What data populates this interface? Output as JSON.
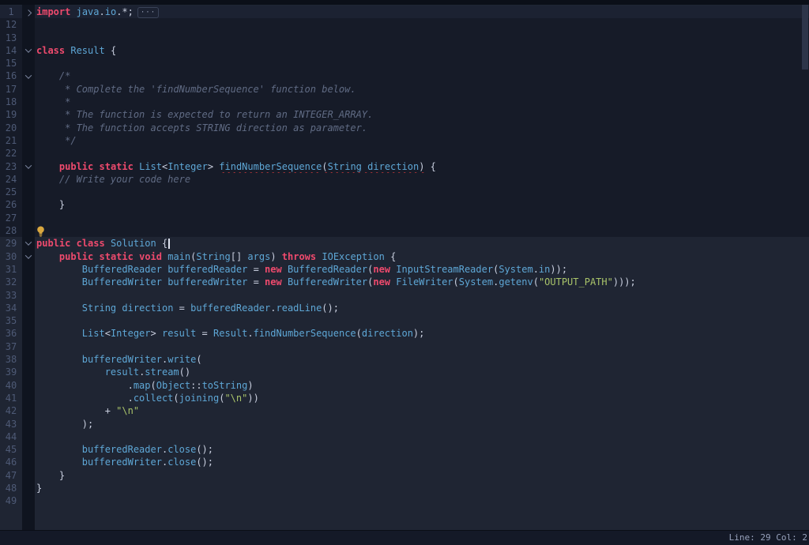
{
  "editor": {
    "language": "java",
    "fold_ellipsis": "···",
    "status_bar": {
      "text": "Line: 29 Col: 2"
    },
    "shade": {
      "dark_through": 28,
      "highlight_line": 1
    },
    "colors": {
      "keyword": "#ee4a6d",
      "identifier": "#5ea7d6",
      "punctuation": "#c9cfdf",
      "comment": "#606b84",
      "string": "#a9c46a",
      "line_number": "#4e5a76",
      "error_underline": "#e23c3c",
      "bg_dark_region": "#161b28",
      "bg_light_region": "#1f2533",
      "bg_highlight_line": "#1c2232",
      "gutter_strip": "#0f141f",
      "top_strip": "#0b0f18",
      "status_bar_bg": "#141927",
      "status_text": "#97a1bb",
      "cursor": "#dde2ee",
      "lightbulb": "#d9a73f",
      "chevron": "#79839c",
      "scroll_thumb": "#2d3549",
      "badge_border": "#3a4358"
    },
    "lines": [
      {
        "num": 1,
        "fold": "closed",
        "badge": true,
        "tokens": [
          {
            "s": "import",
            "c": "kw"
          },
          {
            "s": " ",
            "c": "pl"
          },
          {
            "s": "java",
            "c": "id"
          },
          {
            "s": ".",
            "c": "pu"
          },
          {
            "s": "io",
            "c": "id"
          },
          {
            "s": ".*;",
            "c": "pu"
          }
        ]
      },
      {
        "num": 12,
        "tokens": []
      },
      {
        "num": 13,
        "tokens": []
      },
      {
        "num": 14,
        "fold": "open",
        "tokens": [
          {
            "s": "class",
            "c": "kw"
          },
          {
            "s": " ",
            "c": "pl"
          },
          {
            "s": "Result",
            "c": "id"
          },
          {
            "s": " {",
            "c": "pu"
          }
        ]
      },
      {
        "num": 15,
        "tokens": []
      },
      {
        "num": 16,
        "fold": "open",
        "tokens": [
          {
            "s": "    ",
            "c": "pl"
          },
          {
            "s": "/*",
            "c": "co"
          }
        ]
      },
      {
        "num": 17,
        "tokens": [
          {
            "s": "     * Complete the 'findNumberSequence' function below.",
            "c": "co"
          }
        ]
      },
      {
        "num": 18,
        "tokens": [
          {
            "s": "     *",
            "c": "co"
          }
        ]
      },
      {
        "num": 19,
        "tokens": [
          {
            "s": "     * The function is expected to return an INTEGER_ARRAY.",
            "c": "co"
          }
        ]
      },
      {
        "num": 20,
        "tokens": [
          {
            "s": "     * The function accepts STRING direction as parameter.",
            "c": "co"
          }
        ]
      },
      {
        "num": 21,
        "tokens": [
          {
            "s": "     */",
            "c": "co"
          }
        ]
      },
      {
        "num": 22,
        "tokens": []
      },
      {
        "num": 23,
        "fold": "open",
        "tokens": [
          {
            "s": "    ",
            "c": "pl"
          },
          {
            "s": "public",
            "c": "kw"
          },
          {
            "s": " ",
            "c": "pl"
          },
          {
            "s": "static",
            "c": "kw"
          },
          {
            "s": " ",
            "c": "pl"
          },
          {
            "s": "List",
            "c": "id"
          },
          {
            "s": "<",
            "c": "pu"
          },
          {
            "s": "Integer",
            "c": "id"
          },
          {
            "s": ">",
            "c": "pu"
          },
          {
            "s": " ",
            "c": "pl"
          },
          {
            "s": "findNumberSequence",
            "c": "id sq"
          },
          {
            "s": "(",
            "c": "pu sq"
          },
          {
            "s": "String",
            "c": "id sq"
          },
          {
            "s": " ",
            "c": "pl sq"
          },
          {
            "s": "direction",
            "c": "id sq"
          },
          {
            "s": ")",
            "c": "pu sq"
          },
          {
            "s": " {",
            "c": "pu"
          }
        ]
      },
      {
        "num": 24,
        "tokens": [
          {
            "s": "    ",
            "c": "pl"
          },
          {
            "s": "// Write your code here",
            "c": "co"
          }
        ]
      },
      {
        "num": 25,
        "tokens": []
      },
      {
        "num": 26,
        "tokens": [
          {
            "s": "    }",
            "c": "pu"
          }
        ]
      },
      {
        "num": 27,
        "tokens": []
      },
      {
        "num": 28,
        "bulb": true,
        "tokens": []
      },
      {
        "num": 29,
        "fold": "open",
        "cursor": true,
        "tokens": [
          {
            "s": "public",
            "c": "kw"
          },
          {
            "s": " ",
            "c": "pl"
          },
          {
            "s": "class",
            "c": "kw"
          },
          {
            "s": " ",
            "c": "pl"
          },
          {
            "s": "Solution",
            "c": "id"
          },
          {
            "s": " ",
            "c": "pl"
          },
          {
            "s": "{",
            "c": "pu"
          }
        ]
      },
      {
        "num": 30,
        "fold": "open",
        "tokens": [
          {
            "s": "    ",
            "c": "pl"
          },
          {
            "s": "public",
            "c": "kw"
          },
          {
            "s": " ",
            "c": "pl"
          },
          {
            "s": "static",
            "c": "kw"
          },
          {
            "s": " ",
            "c": "pl"
          },
          {
            "s": "void",
            "c": "kw"
          },
          {
            "s": " ",
            "c": "pl"
          },
          {
            "s": "main",
            "c": "id"
          },
          {
            "s": "(",
            "c": "pu"
          },
          {
            "s": "String",
            "c": "id"
          },
          {
            "s": "[] ",
            "c": "pu"
          },
          {
            "s": "args",
            "c": "id"
          },
          {
            "s": ") ",
            "c": "pu"
          },
          {
            "s": "throws",
            "c": "kw"
          },
          {
            "s": " ",
            "c": "pl"
          },
          {
            "s": "IOException",
            "c": "id"
          },
          {
            "s": " {",
            "c": "pu"
          }
        ]
      },
      {
        "num": 31,
        "tokens": [
          {
            "s": "        ",
            "c": "pl"
          },
          {
            "s": "BufferedReader",
            "c": "id"
          },
          {
            "s": " ",
            "c": "pl"
          },
          {
            "s": "bufferedReader",
            "c": "id"
          },
          {
            "s": " = ",
            "c": "pu"
          },
          {
            "s": "new",
            "c": "kw"
          },
          {
            "s": " ",
            "c": "pl"
          },
          {
            "s": "BufferedReader",
            "c": "id"
          },
          {
            "s": "(",
            "c": "pu"
          },
          {
            "s": "new",
            "c": "kw"
          },
          {
            "s": " ",
            "c": "pl"
          },
          {
            "s": "InputStreamReader",
            "c": "id"
          },
          {
            "s": "(",
            "c": "pu"
          },
          {
            "s": "System",
            "c": "id"
          },
          {
            "s": ".",
            "c": "pu"
          },
          {
            "s": "in",
            "c": "id"
          },
          {
            "s": "));",
            "c": "pu"
          }
        ]
      },
      {
        "num": 32,
        "tokens": [
          {
            "s": "        ",
            "c": "pl"
          },
          {
            "s": "BufferedWriter",
            "c": "id"
          },
          {
            "s": " ",
            "c": "pl"
          },
          {
            "s": "bufferedWriter",
            "c": "id"
          },
          {
            "s": " = ",
            "c": "pu"
          },
          {
            "s": "new",
            "c": "kw"
          },
          {
            "s": " ",
            "c": "pl"
          },
          {
            "s": "BufferedWriter",
            "c": "id"
          },
          {
            "s": "(",
            "c": "pu"
          },
          {
            "s": "new",
            "c": "kw"
          },
          {
            "s": " ",
            "c": "pl"
          },
          {
            "s": "FileWriter",
            "c": "id"
          },
          {
            "s": "(",
            "c": "pu"
          },
          {
            "s": "System",
            "c": "id"
          },
          {
            "s": ".",
            "c": "pu"
          },
          {
            "s": "getenv",
            "c": "id"
          },
          {
            "s": "(",
            "c": "pu"
          },
          {
            "s": "\"OUTPUT_PATH\"",
            "c": "st"
          },
          {
            "s": ")));",
            "c": "pu"
          }
        ]
      },
      {
        "num": 33,
        "tokens": []
      },
      {
        "num": 34,
        "tokens": [
          {
            "s": "        ",
            "c": "pl"
          },
          {
            "s": "String",
            "c": "id"
          },
          {
            "s": " ",
            "c": "pl"
          },
          {
            "s": "direction",
            "c": "id"
          },
          {
            "s": " = ",
            "c": "pu"
          },
          {
            "s": "bufferedReader",
            "c": "id"
          },
          {
            "s": ".",
            "c": "pu"
          },
          {
            "s": "readLine",
            "c": "id"
          },
          {
            "s": "();",
            "c": "pu"
          }
        ]
      },
      {
        "num": 35,
        "tokens": []
      },
      {
        "num": 36,
        "tokens": [
          {
            "s": "        ",
            "c": "pl"
          },
          {
            "s": "List",
            "c": "id"
          },
          {
            "s": "<",
            "c": "pu"
          },
          {
            "s": "Integer",
            "c": "id"
          },
          {
            "s": "> ",
            "c": "pu"
          },
          {
            "s": "result",
            "c": "id"
          },
          {
            "s": " = ",
            "c": "pu"
          },
          {
            "s": "Result",
            "c": "id"
          },
          {
            "s": ".",
            "c": "pu"
          },
          {
            "s": "findNumberSequence",
            "c": "id"
          },
          {
            "s": "(",
            "c": "pu"
          },
          {
            "s": "direction",
            "c": "id"
          },
          {
            "s": ");",
            "c": "pu"
          }
        ]
      },
      {
        "num": 37,
        "tokens": []
      },
      {
        "num": 38,
        "tokens": [
          {
            "s": "        ",
            "c": "pl"
          },
          {
            "s": "bufferedWriter",
            "c": "id"
          },
          {
            "s": ".",
            "c": "pu"
          },
          {
            "s": "write",
            "c": "id"
          },
          {
            "s": "(",
            "c": "pu"
          }
        ]
      },
      {
        "num": 39,
        "tokens": [
          {
            "s": "            ",
            "c": "pl"
          },
          {
            "s": "result",
            "c": "id"
          },
          {
            "s": ".",
            "c": "pu"
          },
          {
            "s": "stream",
            "c": "id"
          },
          {
            "s": "()",
            "c": "pu"
          }
        ]
      },
      {
        "num": 40,
        "tokens": [
          {
            "s": "                ",
            "c": "pl"
          },
          {
            "s": ".",
            "c": "pu"
          },
          {
            "s": "map",
            "c": "id"
          },
          {
            "s": "(",
            "c": "pu"
          },
          {
            "s": "Object",
            "c": "id"
          },
          {
            "s": "::",
            "c": "pu"
          },
          {
            "s": "toString",
            "c": "id"
          },
          {
            "s": ")",
            "c": "pu"
          }
        ]
      },
      {
        "num": 41,
        "tokens": [
          {
            "s": "                ",
            "c": "pl"
          },
          {
            "s": ".",
            "c": "pu"
          },
          {
            "s": "collect",
            "c": "id"
          },
          {
            "s": "(",
            "c": "pu"
          },
          {
            "s": "joining",
            "c": "id"
          },
          {
            "s": "(",
            "c": "pu"
          },
          {
            "s": "\"\\n\"",
            "c": "st"
          },
          {
            "s": "))",
            "c": "pu"
          }
        ]
      },
      {
        "num": 42,
        "tokens": [
          {
            "s": "            + ",
            "c": "pu"
          },
          {
            "s": "\"\\n\"",
            "c": "st"
          }
        ]
      },
      {
        "num": 43,
        "tokens": [
          {
            "s": "        );",
            "c": "pu"
          }
        ]
      },
      {
        "num": 44,
        "tokens": []
      },
      {
        "num": 45,
        "tokens": [
          {
            "s": "        ",
            "c": "pl"
          },
          {
            "s": "bufferedReader",
            "c": "id"
          },
          {
            "s": ".",
            "c": "pu"
          },
          {
            "s": "close",
            "c": "id"
          },
          {
            "s": "();",
            "c": "pu"
          }
        ]
      },
      {
        "num": 46,
        "tokens": [
          {
            "s": "        ",
            "c": "pl"
          },
          {
            "s": "bufferedWriter",
            "c": "id"
          },
          {
            "s": ".",
            "c": "pu"
          },
          {
            "s": "close",
            "c": "id"
          },
          {
            "s": "();",
            "c": "pu"
          }
        ]
      },
      {
        "num": 47,
        "tokens": [
          {
            "s": "    }",
            "c": "pu"
          }
        ]
      },
      {
        "num": 48,
        "tokens": [
          {
            "s": "}",
            "c": "pu"
          }
        ]
      },
      {
        "num": 49,
        "tokens": []
      }
    ]
  }
}
